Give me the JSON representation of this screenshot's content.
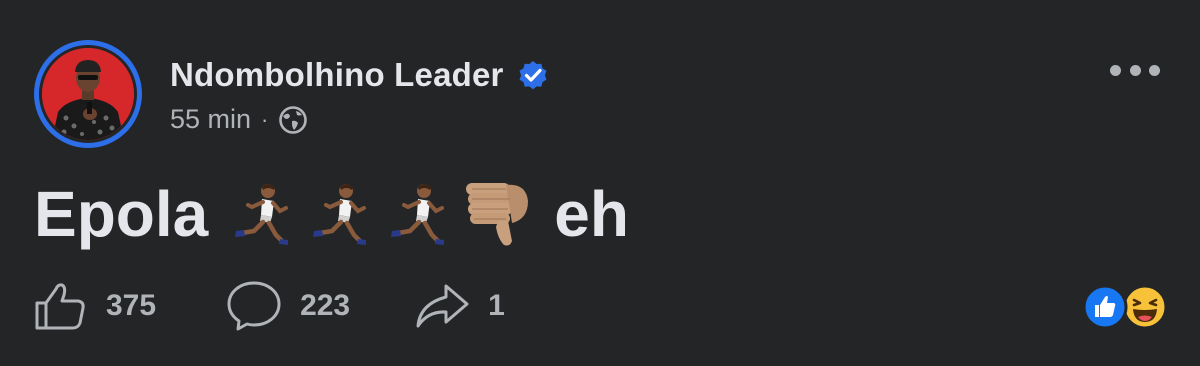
{
  "post": {
    "author": "Ndombolhino Leader",
    "verified": true,
    "time": "55 min",
    "separator": "·",
    "audience_icon": "globe-icon",
    "text_before": "Epola",
    "emojis": [
      "running-man-emoji",
      "running-man-emoji",
      "running-man-emoji",
      "thumbs-down-emoji"
    ],
    "text_after": "eh"
  },
  "stats": {
    "likes": "375",
    "comments": "223",
    "shares": "1",
    "reactions": [
      "like-reaction-icon",
      "haha-reaction-icon"
    ]
  },
  "colors": {
    "background": "#242526",
    "primary_text": "#e4e6eb",
    "secondary_text": "#b0b3b8",
    "accent_blue": "#2d6fe8"
  }
}
